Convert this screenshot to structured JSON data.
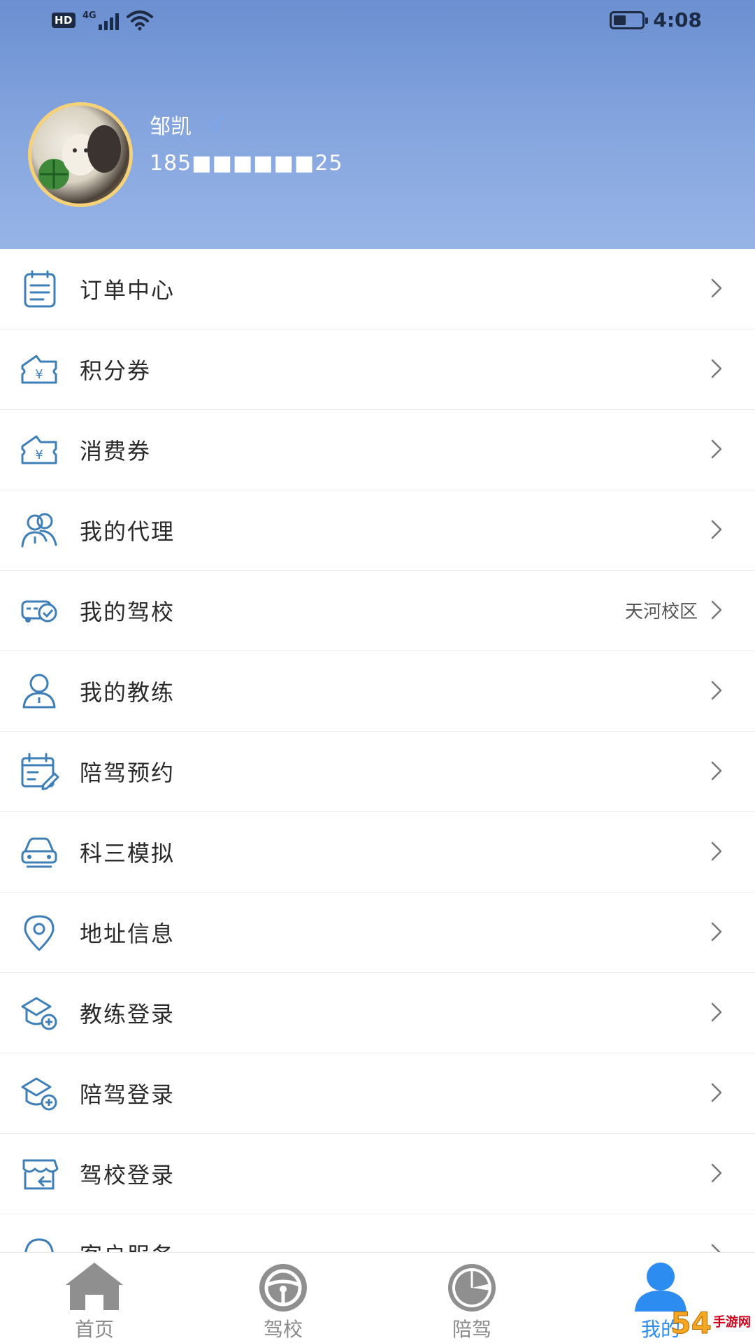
{
  "status_bar": {
    "hd": "HD",
    "network": "4G",
    "time": "4:08",
    "battery_level": 0.45
  },
  "profile": {
    "name": "邹凯",
    "gender_symbol": "♂",
    "phone": "185■■■■■■25"
  },
  "menu": {
    "items": [
      {
        "label": "订单中心",
        "icon": "order-list-icon",
        "value": ""
      },
      {
        "label": "积分券",
        "icon": "points-coupon-icon",
        "value": ""
      },
      {
        "label": "消费券",
        "icon": "consumption-coupon-icon",
        "value": ""
      },
      {
        "label": "我的代理",
        "icon": "agent-users-icon",
        "value": ""
      },
      {
        "label": "我的驾校",
        "icon": "driving-school-icon",
        "value": "天河校区"
      },
      {
        "label": "我的教练",
        "icon": "coach-person-icon",
        "value": ""
      },
      {
        "label": "陪驾预约",
        "icon": "calendar-edit-icon",
        "value": ""
      },
      {
        "label": "科三模拟",
        "icon": "car-icon",
        "value": ""
      },
      {
        "label": "地址信息",
        "icon": "location-pin-icon",
        "value": ""
      },
      {
        "label": "教练登录",
        "icon": "coach-login-icon",
        "value": ""
      },
      {
        "label": "陪驾登录",
        "icon": "companion-login-icon",
        "value": ""
      },
      {
        "label": "驾校登录",
        "icon": "school-login-icon",
        "value": ""
      },
      {
        "label": "客户服务",
        "icon": "customer-service-icon",
        "value": ""
      }
    ]
  },
  "tabbar": {
    "tabs": [
      {
        "label": "首页",
        "icon": "home-icon"
      },
      {
        "label": "驾校",
        "icon": "steering-wheel-icon"
      },
      {
        "label": "陪驾",
        "icon": "speedometer-icon"
      },
      {
        "label": "我的",
        "icon": "user-icon"
      }
    ],
    "active_index": 3
  },
  "watermark": {
    "number": "54",
    "text": "手游网"
  },
  "colors": {
    "header_top": "#6b8fd0",
    "header_bottom": "#97b4e6",
    "icon_blue": "#3f7fb8",
    "active_tab": "#2d8cf0",
    "inactive_tab": "#8a8a8a"
  }
}
